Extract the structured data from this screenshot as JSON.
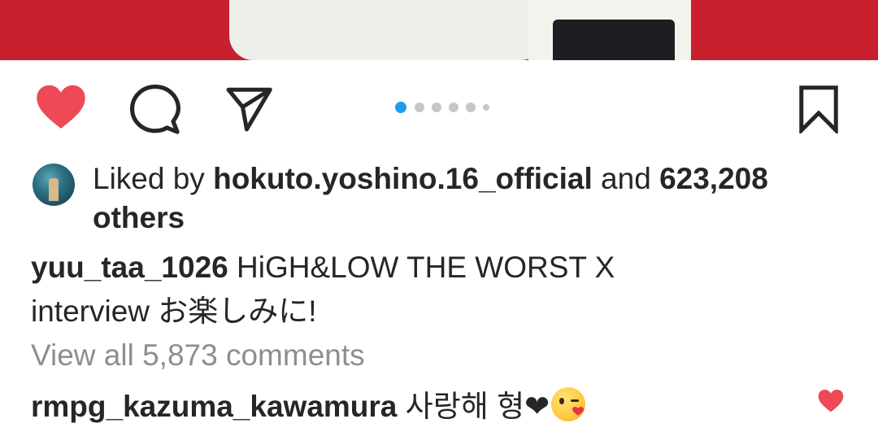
{
  "post": {
    "liked_by_prefix": "Liked by ",
    "liked_by_user": "hokuto.yoshino.16_official",
    "liked_by_and": " and ",
    "likes_count": "623,208",
    "likes_others": "others",
    "caption_user": "yuu_taa_1026",
    "caption_text_line1": " HiGH&LOW THE WORST X",
    "caption_text_line2": "interview お楽しみに!",
    "view_all_comments": "View all 5,873 comments",
    "comment_user": "rmpg_kazuma_kawamura",
    "comment_text": " 사랑해 형❤",
    "carousel": {
      "total": 6,
      "active_index": 0
    }
  },
  "icons": {
    "like": "heart-filled-icon",
    "comment": "comment-bubble-icon",
    "share": "paper-plane-icon",
    "save": "bookmark-icon",
    "comment_like": "small-heart-icon",
    "emoji": "kissing-face-emoji"
  },
  "colors": {
    "like_red": "#ed4956",
    "carousel_active": "#1f9bf0",
    "carousel_inactive": "#c7c7c7",
    "muted_text": "#8e8e8e"
  }
}
